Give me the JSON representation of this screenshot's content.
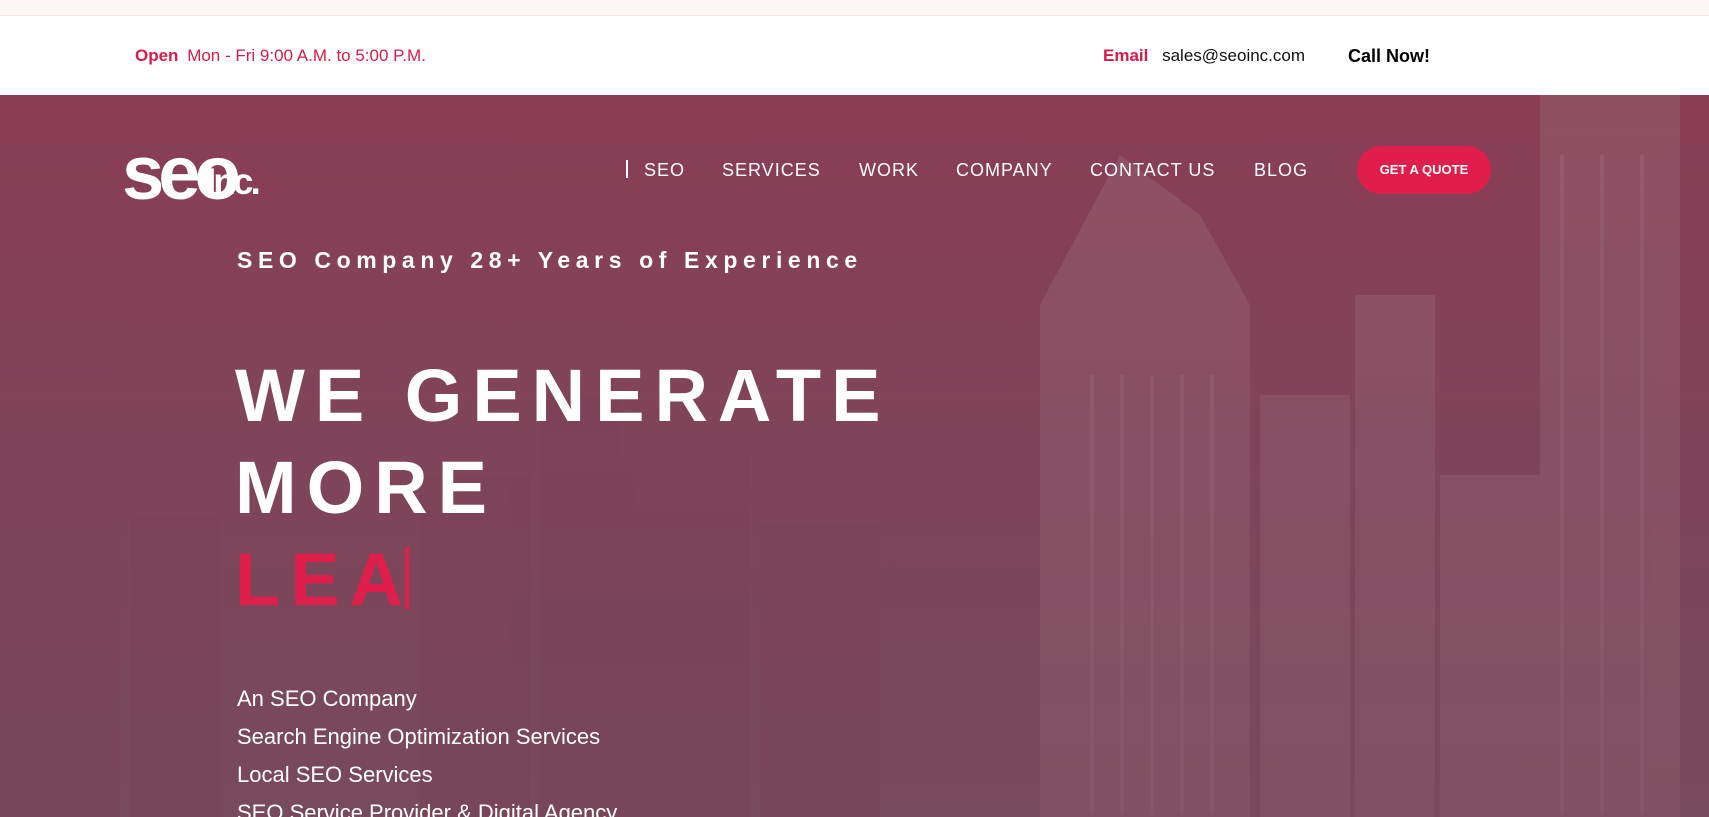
{
  "topbar": {
    "open_label": "Open",
    "hours": "Mon - Fri 9:00 A.M. to 5:00 P.M.",
    "email_label": "Email",
    "email": "sales@seoinc.com",
    "call_label": "Call Now!"
  },
  "logo": {
    "main": "seo",
    "suffix": "Inc."
  },
  "nav": {
    "items": [
      "SEO",
      "SERVICES",
      "WORK",
      "COMPANY",
      "CONTACT US",
      "BLOG"
    ],
    "cta": "GET A QUOTE"
  },
  "hero": {
    "tagline": "SEO Company 28+ Years of Experience",
    "headline_line1": "WE GENERATE",
    "headline_line2": "MORE",
    "headline_typed": "LEA",
    "services": [
      "An  SEO Company",
      "Search Engine Optimization Services",
      "Local SEO Services",
      "SEO Service Provider & Digital Agency"
    ]
  },
  "colors": {
    "accent": "#e01e4c",
    "hero_overlay": "#85435b",
    "text_light": "#ffffff"
  },
  "icons": [
    "nav-divider-icon"
  ]
}
